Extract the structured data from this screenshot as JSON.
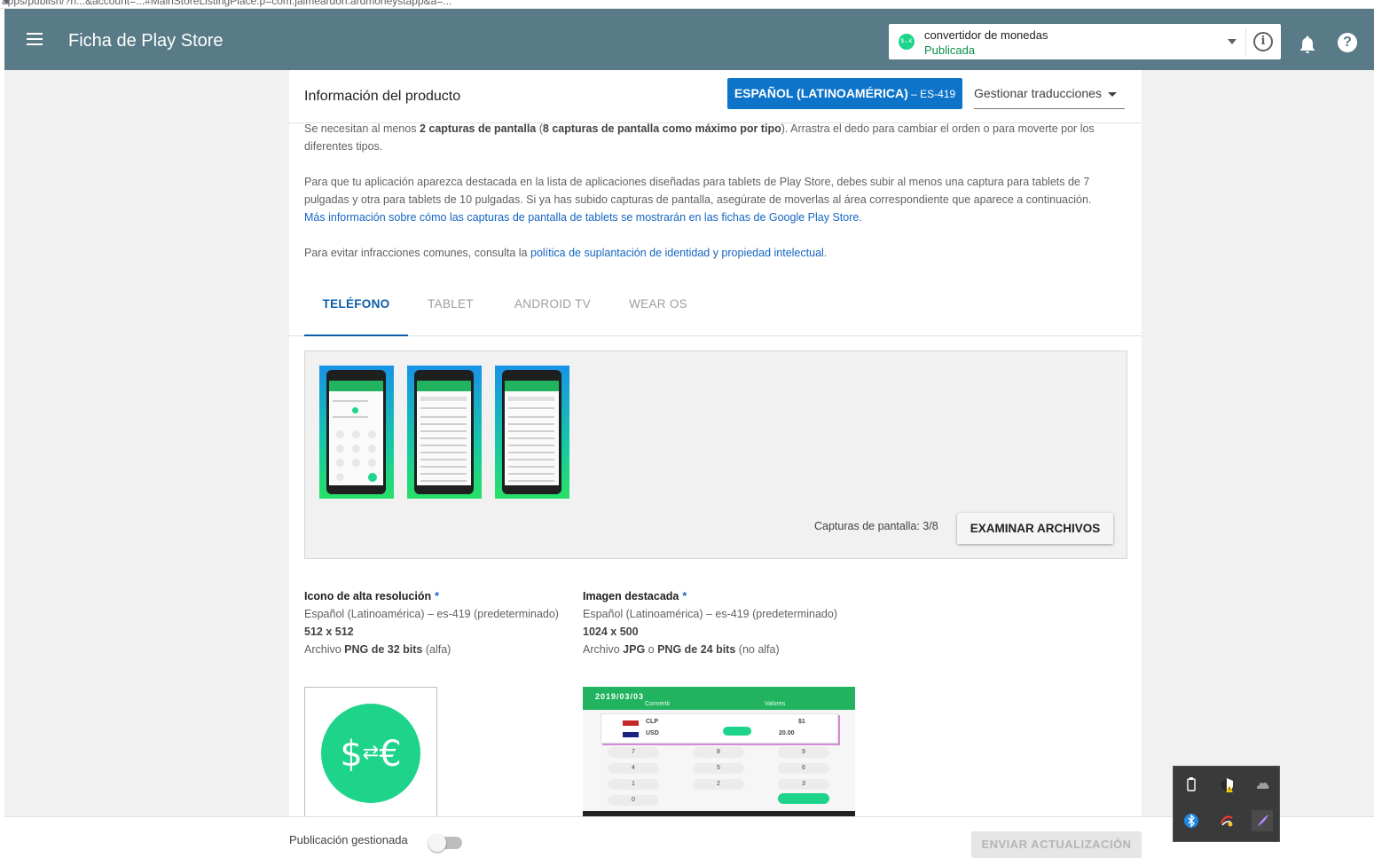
{
  "address_bar": {
    "url_fragment": "apps/publish/?h...&account=...#MainStoreListingPlace:p=com.jaimeardon.ardmoneystapp&a=...",
    "star": "★"
  },
  "topbar": {
    "title": "Ficha de Play Store",
    "app_name": "convertidor de monedas",
    "app_status": "Publicada",
    "app_icon_glyph": "$↔€",
    "info_glyph": "i",
    "help_glyph": "?"
  },
  "card": {
    "title": "Información del producto",
    "language_button": "ESPAÑOL (LATINOAMÉRICA)",
    "language_code": " – ES-419",
    "translations_select": "Gestionar traducciones"
  },
  "body": {
    "p1_pre": "Se necesitan al menos ",
    "p1_b1": "2 capturas de pantalla",
    "p1_mid": " (",
    "p1_b2": "8 capturas de pantalla como máximo por tipo",
    "p1_post": "). Arrastra el dedo para cambiar el orden o para moverte por los diferentes tipos.",
    "p2_text": "Para que tu aplicación aparezca destacada en la lista de aplicaciones diseñadas para tablets de Play Store, debes subir al menos una captura para tablets de 7 pulgadas y otra para tablets de 10 pulgadas. Si ya has subido capturas de pantalla, asegúrate de moverlas al área correspondiente que aparece a continuación.",
    "p2_link": "Más información sobre cómo las capturas de pantalla de tablets se mostrarán en las fichas de Google Play Store.",
    "p3_pre": "Para evitar infracciones comunes, consulta la ",
    "p3_link": "política de suplantación de identidad y propiedad intelectual",
    "p3_post": "."
  },
  "tabs": [
    {
      "label": "TELÉFONO",
      "active": true
    },
    {
      "label": "TABLET",
      "active": false
    },
    {
      "label": "ANDROID TV",
      "active": false
    },
    {
      "label": "WEAR OS",
      "active": false
    }
  ],
  "screenshots": {
    "count_label": "Capturas de pantalla: 3/8",
    "browse_button": "EXAMINAR ARCHIVOS",
    "items": [
      "screenshot-1",
      "screenshot-2",
      "screenshot-3"
    ]
  },
  "hires_icon": {
    "heading": "Icono de alta resolución",
    "required_mark": "*",
    "language": "Español (Latinoamérica) – es-419 (predeterminado)",
    "size": "512 x 512",
    "format_pre": "Archivo ",
    "format_b": "PNG de 32 bits",
    "format_post": " (alfa)",
    "glyph_dollar": "$",
    "glyph_arrows": "⇄",
    "glyph_euro": "€"
  },
  "feature_graphic": {
    "heading": "Imagen destacada",
    "required_mark": "*",
    "language": "Español (Latinoamérica) – es-419 (predeterminado)",
    "size": "1024 x 500",
    "format_pre": "Archivo ",
    "format_b1": "JPG",
    "format_mid": " o ",
    "format_b2": "PNG de 24 bits",
    "format_post": " (no alfa)",
    "preview_date": "2019/03/03",
    "preview_tab1": "Convertir",
    "preview_tab2": "Valores",
    "preview_row1_code": "CLP",
    "preview_row1_value": "$1",
    "preview_row2_code": "USD",
    "preview_row2_value": "20.00",
    "preview_keys": [
      "7",
      "8",
      "9",
      "4",
      "5",
      "6",
      "1",
      "2",
      "3",
      "0"
    ]
  },
  "bottom_bar": {
    "label": "Publicación gestionada",
    "send_button": "ENVIAR ACTUALIZACIÓN"
  },
  "colors": {
    "topbar": "#587b87",
    "accent": "#0d74c9",
    "brand_green": "#1ed48b",
    "published": "#0b8f4c"
  }
}
